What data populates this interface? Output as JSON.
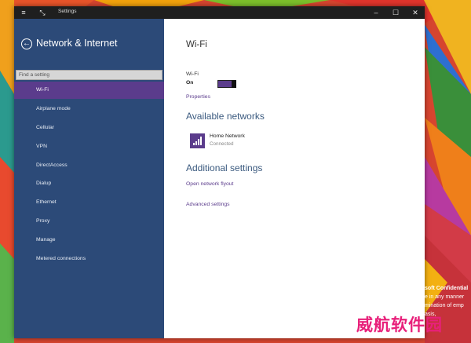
{
  "window": {
    "title": "Settings",
    "minimize": "–",
    "maximize": "☐",
    "close": "✕",
    "hamburger": "≡",
    "tablet": "⤡"
  },
  "sidebar": {
    "back": "←",
    "title": "Network & Internet",
    "search_placeholder": "Find a setting",
    "items": [
      {
        "label": "Wi-Fi"
      },
      {
        "label": "Airplane mode"
      },
      {
        "label": "Cellular"
      },
      {
        "label": "VPN"
      },
      {
        "label": "DirectAccess"
      },
      {
        "label": "Dialup"
      },
      {
        "label": "Ethernet"
      },
      {
        "label": "Proxy"
      },
      {
        "label": "Manage"
      },
      {
        "label": "Metered connections"
      }
    ],
    "selected_index": 0
  },
  "main": {
    "heading": "Wi-Fi",
    "wifi_label": "Wi-Fi",
    "wifi_state": "On",
    "properties_link": "Properties",
    "available_heading": "Available networks",
    "network": {
      "name": "Home Network",
      "status": "Connected"
    },
    "additional_heading": "Additional settings",
    "open_flyout_link": "Open network flyout",
    "advanced_link": "Advanced settings"
  },
  "colors": {
    "accent": "#5b3c8c",
    "sidebar_bg": "#2c4a78",
    "titlebar_bg": "#1f1f1f",
    "heading_blue": "#3b5a7f"
  },
  "desktop": {
    "confidential_lines": [
      "soft Confidential",
      "e in any manner",
      "mination of emp",
      "asis,"
    ],
    "watermark": "威航软件园"
  }
}
